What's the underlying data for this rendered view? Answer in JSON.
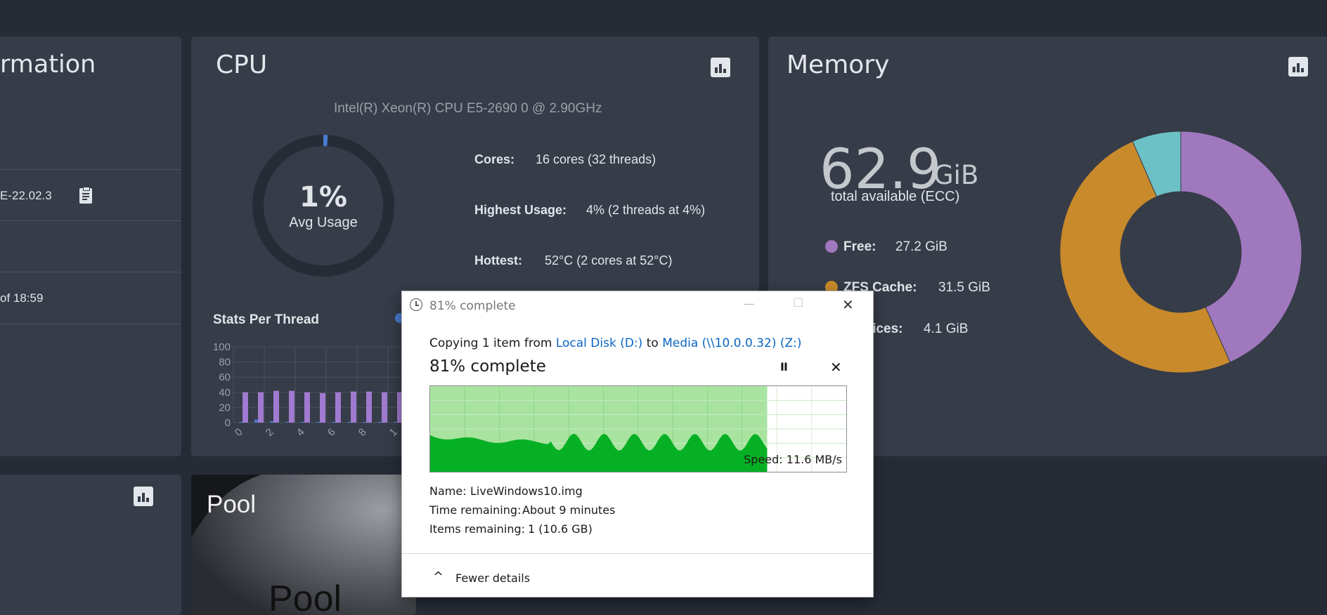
{
  "system_card": {
    "title_partial": "rmation",
    "version_partial": "E-22.02.3",
    "uptime_partial": "of 18:59"
  },
  "cpu_card": {
    "title": "CPU",
    "model": "Intel(R) Xeon(R) CPU E5-2690 0 @ 2.90GHz",
    "usage_value": "1%",
    "usage_label": "Avg Usage",
    "usage_fraction": 0.01,
    "stats": [
      {
        "label": "Cores:",
        "value": "16 cores  (32 threads)"
      },
      {
        "label": "Highest Usage:",
        "value": "4%  (2 threads at 4%)"
      },
      {
        "label": "Hottest:",
        "value": "52°C  (2 cores at 52°C)"
      }
    ],
    "thread_chart_title": "Stats Per Thread"
  },
  "memory_card": {
    "title": "Memory",
    "total_value": "62.9",
    "total_unit": "GiB",
    "total_label": "total available (ECC)",
    "legend": [
      {
        "label": "Free:",
        "value": "27.2 GiB",
        "color": "#a078be"
      },
      {
        "label": "ZFS Cache:",
        "value": "31.5 GiB",
        "color": "#c98a2b"
      },
      {
        "label": "Services:",
        "value": "4.1 GiB",
        "color": "#6cc1c6"
      }
    ]
  },
  "pool_card": {
    "title": "Pool",
    "big_text": "Pool"
  },
  "chart_data": [
    {
      "type": "pie",
      "categories": [
        "Free",
        "ZFS Cache",
        "Services"
      ],
      "values": [
        27.2,
        31.5,
        4.1
      ],
      "colors": [
        "#a078be",
        "#c98a2b",
        "#6cc1c6"
      ],
      "donut": true
    },
    {
      "type": "bar",
      "title": "Stats Per Thread",
      "categories": [
        "0",
        "1",
        "2",
        "3",
        "4",
        "5",
        "6",
        "7",
        "8",
        "9",
        "10"
      ],
      "x_tick_labels": [
        "0",
        "2",
        "4",
        "6",
        "8",
        "1"
      ],
      "series": [
        {
          "values": [
            1,
            4,
            2,
            1,
            1,
            1,
            1,
            1,
            1,
            1,
            1
          ],
          "color": "#4a7bd0"
        },
        {
          "values": [
            40,
            40,
            42,
            42,
            40,
            39,
            40,
            41,
            41,
            40,
            40
          ],
          "color": "#a07ad0"
        }
      ],
      "ylim": [
        0,
        100
      ],
      "y_ticks": [
        0,
        20,
        40,
        60,
        80,
        100
      ]
    }
  ],
  "copy_dialog": {
    "window_title": "81% complete",
    "copy_prefix": "Copying 1 item from",
    "source": "Local Disk (D:)",
    "to_word": "to",
    "destination": "Media (\\\\10.0.0.32) (Z:)",
    "percent_label": "81% complete",
    "progress_fraction": 0.81,
    "speed": "Speed: 11.6 MB/s",
    "details": [
      {
        "label": "Name:",
        "value": "LiveWindows10.img"
      },
      {
        "label": "Time remaining:",
        "value": "About 9 minutes"
      },
      {
        "label": "Items remaining:",
        "value": "1 (10.6 GB)"
      }
    ],
    "fewer_details": "Fewer details",
    "pause_glyph": "II",
    "close_glyph": "✕",
    "cancel_glyph": "✕",
    "minimize_glyph": "—",
    "maximize_glyph": "☐",
    "chevron_glyph": "^"
  }
}
